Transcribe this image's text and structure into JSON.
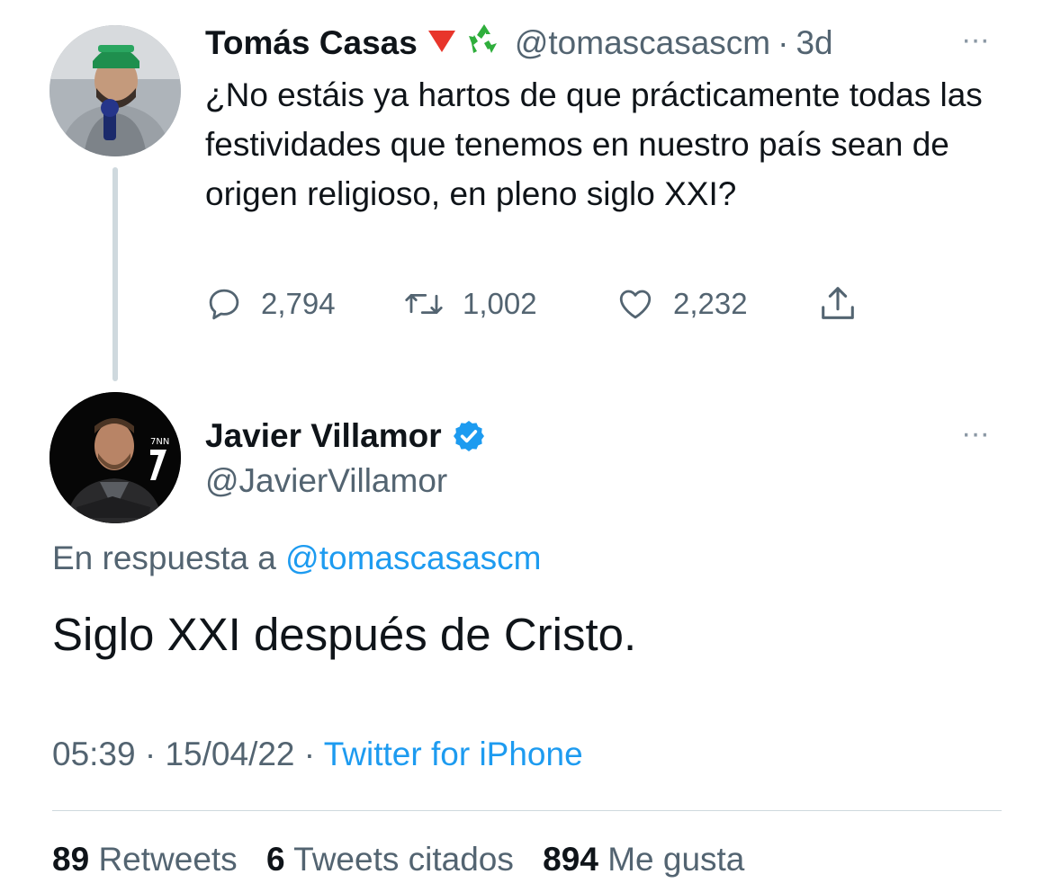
{
  "original_tweet": {
    "author": {
      "name": "Tomás Casas",
      "handle": "@tomascasascm",
      "emojis": [
        "red-triangle-down-icon",
        "recycle-icon"
      ]
    },
    "separator": "·",
    "time_ago": "3d",
    "more_label": "···",
    "text": "¿No estáis ya hartos de que prácticamente todas las festividades que tenemos en nuestro país sean de origen religioso, en pleno siglo XXI?",
    "actions": {
      "replies": "2,794",
      "retweets": "1,002",
      "likes": "2,232"
    }
  },
  "reply_tweet": {
    "author": {
      "name": "Javier Villamor",
      "handle": "@JavierVillamor",
      "verified": true
    },
    "more_label": "···",
    "replying_to_prefix": "En respuesta a",
    "replying_to_handle": "@tomascasascm",
    "text": "Siglo XXI después de Cristo.",
    "time": "05:39",
    "date": "15/04/22",
    "separator": "·",
    "source": "Twitter for iPhone"
  },
  "stats": {
    "retweets_count": "89",
    "retweets_label": "Retweets",
    "quotes_count": "6",
    "quotes_label": "Tweets citados",
    "likes_count": "894",
    "likes_label": "Me gusta"
  },
  "colors": {
    "text_primary": "#0f1419",
    "text_secondary": "#536471",
    "link": "#1d9bf0",
    "verified": "#1d9bf0",
    "divider": "#cfd9de"
  }
}
